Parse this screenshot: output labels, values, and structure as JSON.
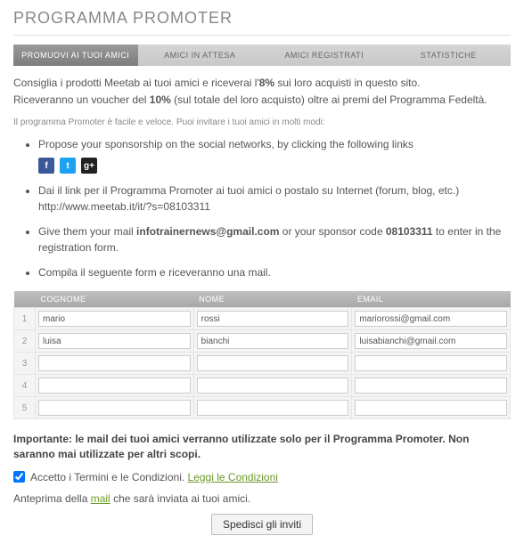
{
  "title": "PROGRAMMA PROMOTER",
  "tabs": {
    "t0": "PROMUOVI AI TUOI AMICI",
    "t1": "AMICI IN ATTESA",
    "t2": "AMICI REGISTRATI",
    "t3": "STATISTICHE"
  },
  "intro": {
    "line1_a": "Consiglia i prodotti Meetab ai tuoi amici e riceverai l'",
    "line1_b": "8%",
    "line1_c": " sui loro acquisti in questo sito.",
    "line2_a": "Riceveranno un voucher del ",
    "line2_b": "10%",
    "line2_c": " (sul totale del loro acquisto) oltre ai premi del Programma Fedeltà."
  },
  "subintro": "Il programma Promoter è facile e veloce. Puoi invitare i tuoi amici in molti modi:",
  "steps": {
    "s1": "Propose your sponsorship on the social networks, by clicking the following links",
    "s2_a": "Dai il link per il Programma Promoter ai tuoi amici o postalo su Internet (forum, blog, etc.)",
    "s2_b": "http://www.meetab.it/it/?s=08103311",
    "s3_a": "Give them your mail ",
    "s3_b": "infotrainernews@gmail.com",
    "s3_c": " or your sponsor code ",
    "s3_d": "08103311",
    "s3_e": " to enter in the registration form.",
    "s4": "Compila il seguente form e riceveranno una mail."
  },
  "social": {
    "fb": "f",
    "tw": "t",
    "gp": "g+"
  },
  "table": {
    "headers": {
      "cognome": "COGNOME",
      "nome": "NOME",
      "email": "EMAIL"
    },
    "rows": {
      "r1": {
        "n": "1",
        "cognome": "mario",
        "nome": "rossi",
        "email": "mariorossi@gmail.com"
      },
      "r2": {
        "n": "2",
        "cognome": "luisa",
        "nome": "bianchi",
        "email": "luisabianchi@gmail.com"
      },
      "r3": {
        "n": "3",
        "cognome": "",
        "nome": "",
        "email": ""
      },
      "r4": {
        "n": "4",
        "cognome": "",
        "nome": "",
        "email": ""
      },
      "r5": {
        "n": "5",
        "cognome": "",
        "nome": "",
        "email": ""
      }
    }
  },
  "important": {
    "a": "Importante: le mail dei tuoi amici verranno utilizzate solo per il Programma Promoter. Non saranno mai utilizzate per altri scopi."
  },
  "accept": {
    "label": "Accetto i Termini e le Condizioni. ",
    "link": "Leggi le Condizioni"
  },
  "preview": {
    "a": "Anteprima della ",
    "b": "mail",
    "c": " che sarà inviata ai tuoi amici."
  },
  "submit": "Spedisci gli inviti"
}
